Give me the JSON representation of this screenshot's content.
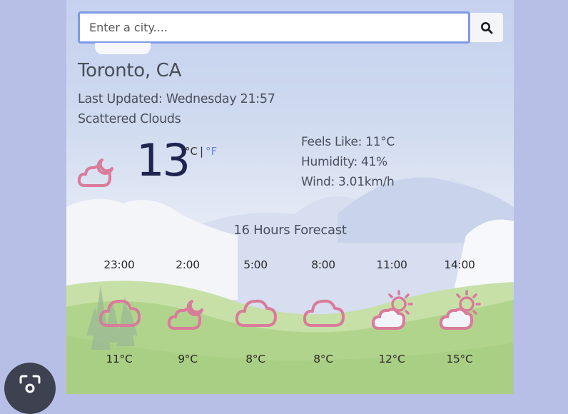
{
  "search": {
    "placeholder": "Enter a city...."
  },
  "location": "Toronto, CA",
  "last_updated": "Last Updated: Wednesday 21:57",
  "description": "Scattered Clouds",
  "current": {
    "temp": "13",
    "unit_c": "°C",
    "unit_sep": "|",
    "unit_f": "°F",
    "icon": "partly-cloudy-night-icon"
  },
  "details": {
    "feels_like": "Feels Like: 11°C",
    "humidity": "Humidity: 41%",
    "wind": "Wind: 3.01km/h"
  },
  "forecast": {
    "title": "16 Hours Forecast",
    "items": [
      {
        "time": "23:00",
        "temp": "11°C",
        "icon": "cloud-icon"
      },
      {
        "time": "2:00",
        "temp": "9°C",
        "icon": "partly-cloudy-night-icon"
      },
      {
        "time": "5:00",
        "temp": "8°C",
        "icon": "cloud-icon"
      },
      {
        "time": "8:00",
        "temp": "8°C",
        "icon": "cloud-icon"
      },
      {
        "time": "11:00",
        "temp": "12°C",
        "icon": "partly-sunny-icon"
      },
      {
        "time": "14:00",
        "temp": "15°C",
        "icon": "partly-sunny-icon"
      }
    ]
  },
  "colors": {
    "page_bg": "#b8bfe6",
    "temp_text": "#1e2550",
    "fahrenheit_link": "#6d83e0",
    "icon_stroke": "#d97b9a",
    "hill_green": "#b1d48c",
    "search_border": "#7f99e6"
  }
}
